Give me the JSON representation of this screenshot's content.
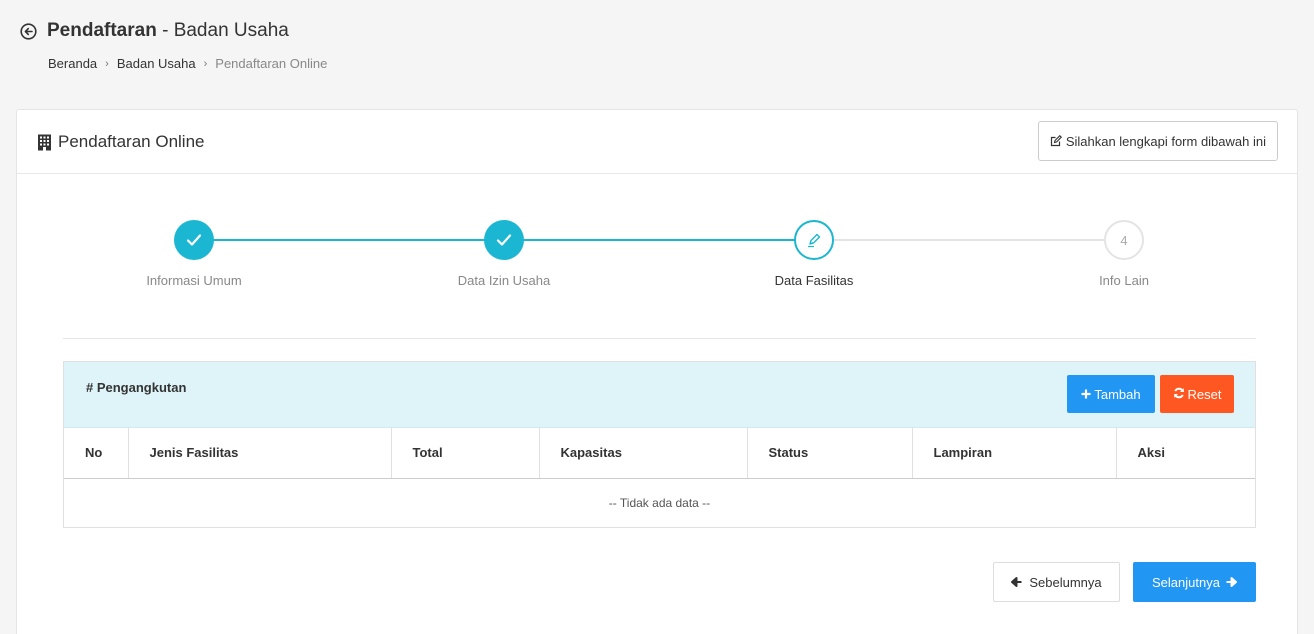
{
  "header": {
    "title_strong": "Pendaftaran",
    "title_rest": " - Badan Usaha",
    "breadcrumb": [
      "Beranda",
      "Badan Usaha",
      "Pendaftaran Online"
    ],
    "breadcrumb_sep": "›"
  },
  "card": {
    "title": "Pendaftaran Online",
    "hint_button": "Silahkan lengkapi form dibawah ini"
  },
  "stepper": {
    "steps": [
      {
        "label": "Informasi Umum",
        "state": "done"
      },
      {
        "label": "Data Izin Usaha",
        "state": "done"
      },
      {
        "label": "Data Fasilitas",
        "state": "current"
      },
      {
        "label": "Info Lain",
        "state": "pending",
        "number": "4"
      }
    ],
    "active_color": "#1bb6d1",
    "inactive_color": "#e4e4e4"
  },
  "panel": {
    "title": "# Pengangkutan",
    "add_button": "Tambah",
    "reset_button": "Reset",
    "columns": [
      "No",
      "Jenis Fasilitas",
      "Total",
      "Kapasitas",
      "Status",
      "Lampiran",
      "Aksi"
    ],
    "empty_text": "-- Tidak ada data --"
  },
  "nav": {
    "prev_button": "Sebelumnya",
    "next_button": "Selanjutnya"
  },
  "colors": {
    "primary": "#2196f3",
    "danger": "#ff5722",
    "info_bg": "#dff4f8"
  }
}
